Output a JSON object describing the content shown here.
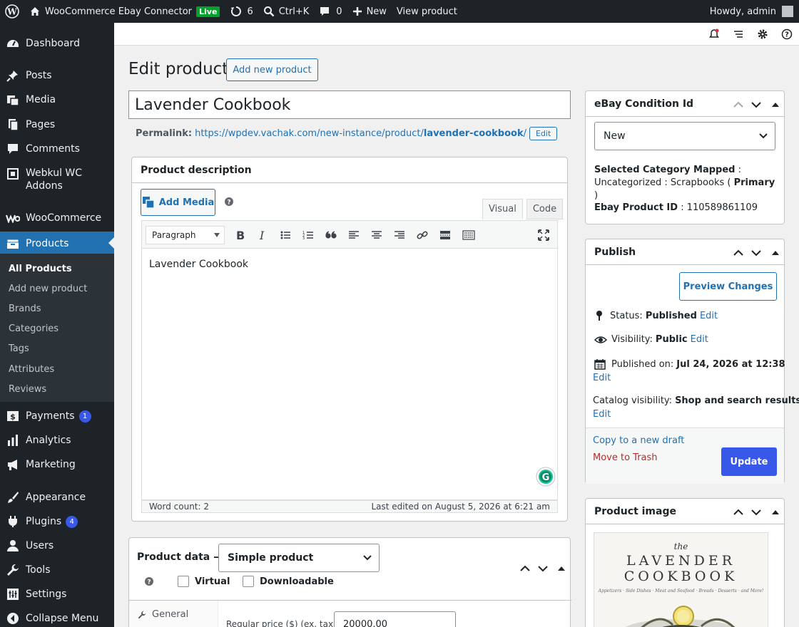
{
  "adminbar": {
    "site_name": "WooCommerce Ebay Connector",
    "live_label": "Live",
    "updates_count": "6",
    "search_shortcut": "Ctrl+K",
    "comments_count": "0",
    "new_label": "New",
    "view_product": "View product",
    "howdy": "Howdy, admin"
  },
  "sidebar": {
    "dashboard": "Dashboard",
    "posts": "Posts",
    "media": "Media",
    "pages": "Pages",
    "comments": "Comments",
    "webkul_1": "Webkul WC",
    "webkul_2": "Addons",
    "woocommerce": "WooCommerce",
    "products": "Products",
    "sub_all": "All Products",
    "sub_add": "Add new product",
    "sub_brands": "Brands",
    "sub_categories": "Categories",
    "sub_tags": "Tags",
    "sub_attributes": "Attributes",
    "sub_reviews": "Reviews",
    "payments": "Payments",
    "payments_badge": "1",
    "analytics": "Analytics",
    "marketing": "Marketing",
    "appearance": "Appearance",
    "plugins": "Plugins",
    "plugins_badge": "4",
    "users": "Users",
    "tools": "Tools",
    "settings": "Settings",
    "collapse": "Collapse Menu"
  },
  "page": {
    "title": "Edit product",
    "add_new": "Add new product",
    "product_title": "Lavender Cookbook",
    "permalink_label": "Permalink:",
    "permalink_base": "https://wpdev.vachak.com/new-instance/product/",
    "permalink_slug": "lavender-cookbook",
    "permalink_end": "/",
    "permalink_edit": "Edit"
  },
  "description": {
    "heading": "Product description",
    "add_media": "Add Media",
    "tab_visual": "Visual",
    "tab_code": "Code",
    "format": "Paragraph",
    "content": "Lavender Cookbook",
    "word_count": "Word count: 2",
    "last_edited": "Last edited on August 5, 2026 at 6:21 am"
  },
  "product_data": {
    "heading": "Product data —",
    "type": "Simple product",
    "virtual": "Virtual",
    "downloadable": "Downloadable",
    "tab_general": "General",
    "price_label": "Regular price ($) (ex. tax)",
    "price_value": "20000.00"
  },
  "ebay": {
    "heading": "eBay Condition Id",
    "condition": "New",
    "mapped_label": "Selected Category Mapped",
    "colon": " :",
    "mapped_value": "Uncategorized : Scrapbooks ( ",
    "primary": "Primary",
    "mapped_close": " )",
    "product_id_label": "Ebay Product ID",
    "product_id_value": " : 110589861109"
  },
  "publish": {
    "heading": "Publish",
    "preview": "Preview Changes",
    "status_label": "Status:",
    "status_value": "Published",
    "visibility_label": "Visibility:",
    "visibility_value": "Public",
    "published_label": "Published on:",
    "published_value": "Jul 24, 2026 at 12:38",
    "catalog_label": "Catalog visibility:",
    "catalog_value": "Shop and search results",
    "edit": "Edit",
    "copy_draft": "Copy to a new draft",
    "trash": "Move to Trash",
    "update": "Update"
  },
  "product_image": {
    "heading": "Product image",
    "book_the": "the",
    "book_line1": "LAVENDER",
    "book_line2": "COOKBOOK",
    "book_sub": "Appetizers · Side Dishes · Meat and Seafood · Breads · Desserts · and More!"
  },
  "colors": {
    "admin_bar": "#1d2327",
    "accent": "#3858e9",
    "link": "#2271b1",
    "current_menu": "#2271b1"
  }
}
